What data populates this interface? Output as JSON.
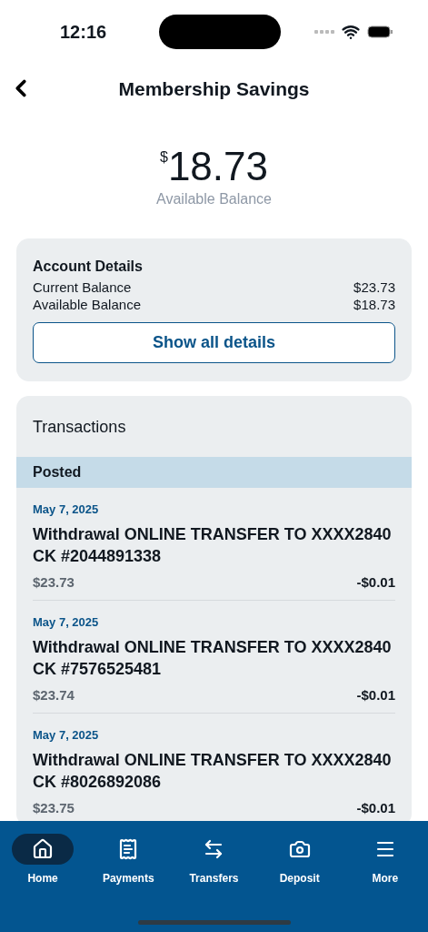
{
  "status_bar": {
    "time": "12:16"
  },
  "header": {
    "title": "Membership Savings"
  },
  "balance": {
    "currency": "$",
    "amount": "18.73",
    "label": "Available Balance"
  },
  "account_details": {
    "title": "Account Details",
    "rows": [
      {
        "label": "Current Balance",
        "value": "$23.73"
      },
      {
        "label": "Available Balance",
        "value": "$18.73"
      }
    ],
    "button": "Show all details"
  },
  "transactions": {
    "title": "Transactions",
    "section": "Posted",
    "items": [
      {
        "date": "May 7, 2025",
        "description": "Withdrawal ONLINE TRANSFER TO XXXX2840 CK #2044891338",
        "balance": "$23.73",
        "amount": "-$0.01"
      },
      {
        "date": "May 7, 2025",
        "description": "Withdrawal ONLINE TRANSFER TO XXXX2840 CK #7576525481",
        "balance": "$23.74",
        "amount": "-$0.01"
      },
      {
        "date": "May 7, 2025",
        "description": "Withdrawal ONLINE TRANSFER TO XXXX2840 CK #8026892086",
        "balance": "$23.75",
        "amount": "-$0.01"
      }
    ]
  },
  "tab_bar": [
    {
      "kind": "home",
      "label": "Home",
      "selected": true
    },
    {
      "kind": "payments",
      "label": "Payments",
      "selected": false
    },
    {
      "kind": "transfers",
      "label": "Transfers",
      "selected": false
    },
    {
      "kind": "deposit",
      "label": "Deposit",
      "selected": false
    },
    {
      "kind": "more",
      "label": "More",
      "selected": false
    }
  ]
}
